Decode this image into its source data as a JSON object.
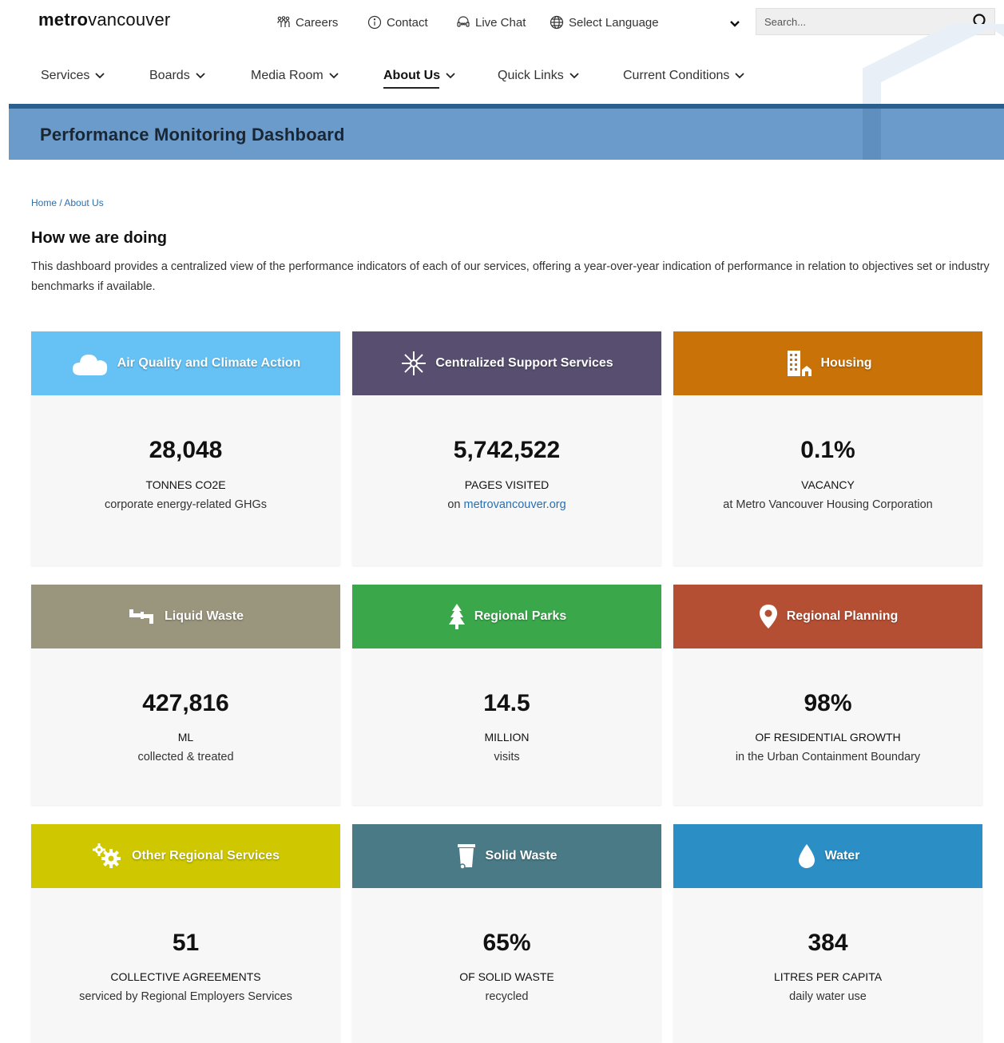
{
  "header": {
    "logo_bold": "metro",
    "logo_light": "vancouver",
    "utility": {
      "careers": "Careers",
      "contact": "Contact",
      "live_chat": "Live Chat",
      "select_language": "Select Language"
    },
    "search": {
      "placeholder": "Search..."
    }
  },
  "nav": {
    "items": [
      {
        "label": "Services"
      },
      {
        "label": "Boards"
      },
      {
        "label": "Media Room"
      },
      {
        "label": "About Us"
      },
      {
        "label": "Quick Links"
      },
      {
        "label": "Current Conditions"
      }
    ],
    "active": "About Us"
  },
  "banner": {
    "title": "Performance Monitoring Dashboard"
  },
  "breadcrumb": {
    "home": "Home",
    "separator": " / ",
    "current": "About Us"
  },
  "section": {
    "title": "How we are doing",
    "intro": "This dashboard provides a centralized view of the performance indicators of each of our services, offering a year-over-year indication of performance in relation to objectives set or industry benchmarks if available."
  },
  "cards": [
    {
      "title": "Air Quality and Climate Action",
      "color": "#66c2f5",
      "icon": "cloud-icon",
      "value": "28,048",
      "unit": "TONNES CO2E",
      "desc": "corporate energy-related GHGs"
    },
    {
      "title": "Centralized Support Services",
      "color": "#584e6f",
      "icon": "network-icon",
      "value": "5,742,522",
      "unit": "PAGES VISITED",
      "desc_prefix": "on ",
      "desc_link": "metrovancouver.org"
    },
    {
      "title": "Housing",
      "color": "#c97208",
      "icon": "building-icon",
      "value": "0.1%",
      "unit": "VACANCY",
      "desc": "at Metro Vancouver Housing Corporation"
    },
    {
      "title": "Liquid Waste",
      "color": "#9a957d",
      "icon": "pipe-icon",
      "value": "427,816",
      "unit": "ML",
      "desc": "collected & treated"
    },
    {
      "title": "Regional Parks",
      "color": "#3aa84a",
      "icon": "tree-icon",
      "value": "14.5",
      "unit": "MILLION",
      "desc": "visits"
    },
    {
      "title": "Regional Planning",
      "color": "#b44f34",
      "icon": "map-pin-icon",
      "value": "98%",
      "unit": "OF RESIDENTIAL GROWTH",
      "desc": "in the Urban Containment Boundary"
    },
    {
      "title": "Other Regional Services",
      "color": "#cfc800",
      "icon": "gears-icon",
      "value": "51",
      "unit": "COLLECTIVE AGREEMENTS",
      "desc": "serviced by Regional Employers Services"
    },
    {
      "title": "Solid Waste",
      "color": "#4a7a85",
      "icon": "trash-bin-icon",
      "value": "65%",
      "unit": "OF SOLID WASTE",
      "desc": "recycled"
    },
    {
      "title": "Water",
      "color": "#2b8ec4",
      "icon": "water-drop-icon",
      "value": "384",
      "unit": "LITRES PER CAPITA",
      "desc": "daily water use"
    }
  ]
}
